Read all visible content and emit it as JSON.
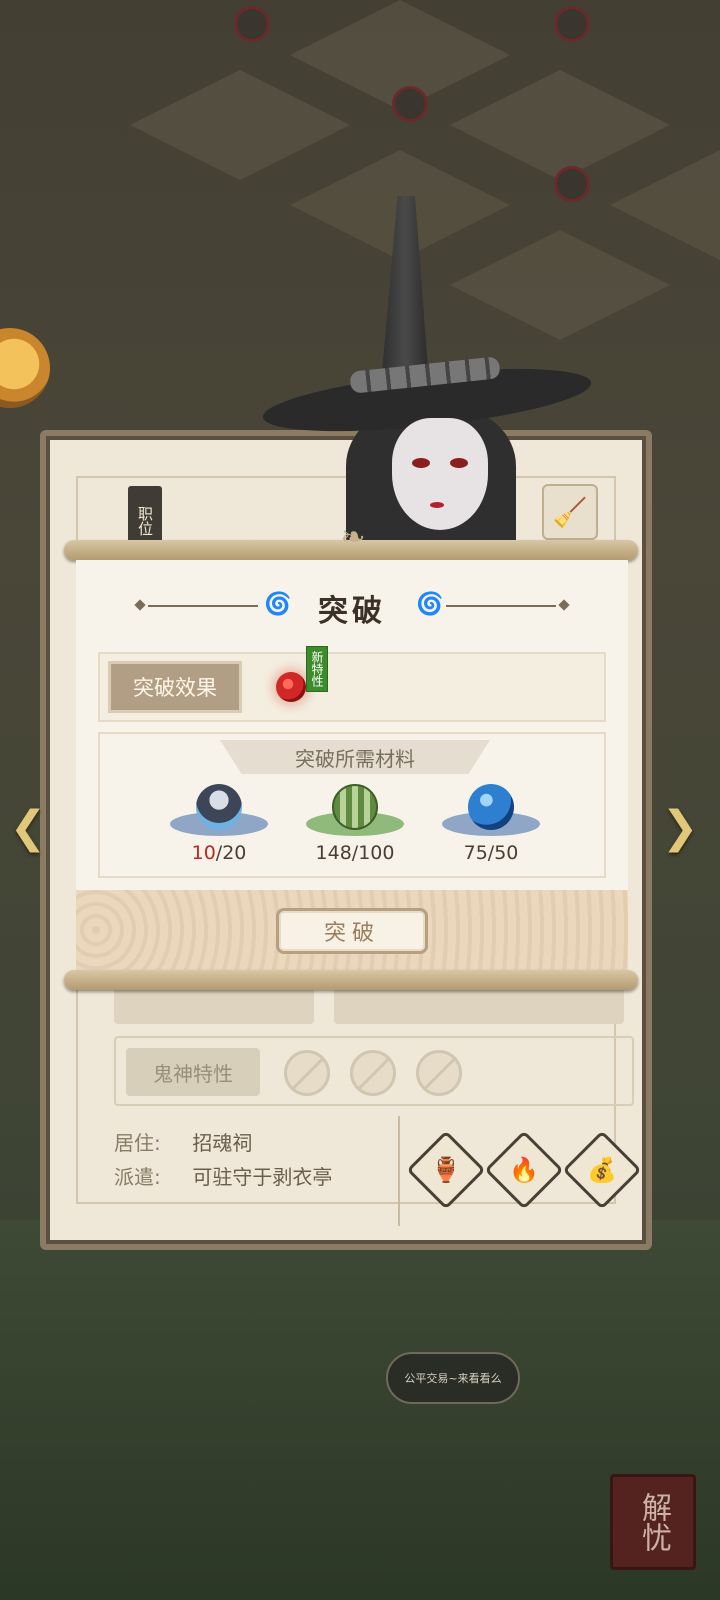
{
  "breakthrough_dialog": {
    "title": "突破",
    "effect_label": "突破效果",
    "new_trait_tag": "新特性",
    "materials_header": "突破所需材料",
    "materials": [
      {
        "icon": "ghost-figure-icon",
        "have": "10",
        "need": "/20",
        "insufficient": true
      },
      {
        "icon": "melon-icon",
        "have": "148",
        "need": "/100",
        "insufficient": false
      },
      {
        "icon": "blue-orb-icon",
        "have": "75",
        "need": "/50",
        "insufficient": false
      }
    ],
    "confirm_label": "突破"
  },
  "info_panel": {
    "role_tag": "职位",
    "trait_label": "鬼神特性",
    "residence_key": "居住:",
    "residence_value": "招魂祠",
    "dispatch_key": "派遣:",
    "dispatch_value": "可驻守于剥衣亭"
  },
  "scene": {
    "bubble_text": "公平交易~来看看么",
    "unlock_seal": "解忧"
  },
  "colors": {
    "insufficient": "#c0251f",
    "scroll_paper": "#f7f3ea",
    "button_border": "#b79f80"
  }
}
